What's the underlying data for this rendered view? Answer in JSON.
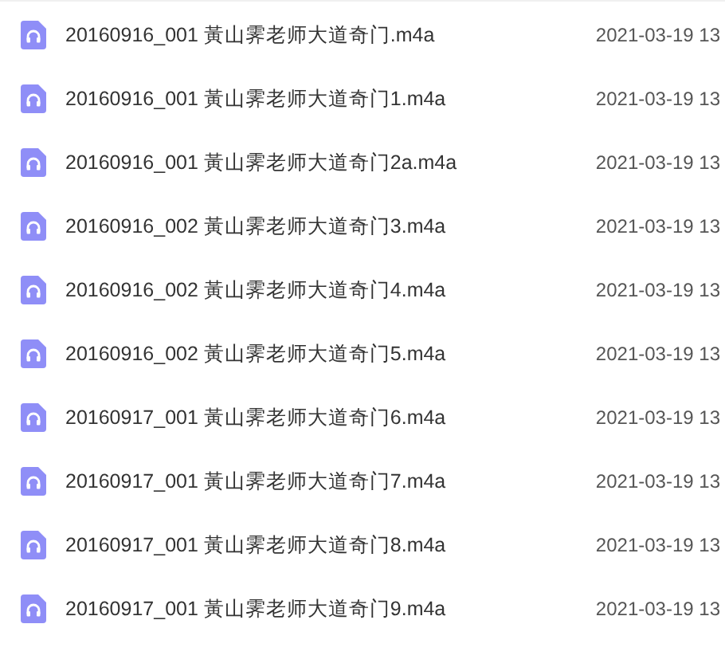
{
  "files": [
    {
      "name": "20160916_001 黃山霁老师大道奇门.m4a",
      "date": "2021-03-19 13"
    },
    {
      "name": "20160916_001 黃山霁老师大道奇门1.m4a",
      "date": "2021-03-19 13"
    },
    {
      "name": "20160916_001 黃山霁老师大道奇门2a.m4a",
      "date": "2021-03-19 13"
    },
    {
      "name": "20160916_002 黃山霁老师大道奇门3.m4a",
      "date": "2021-03-19 13"
    },
    {
      "name": "20160916_002 黃山霁老师大道奇门4.m4a",
      "date": "2021-03-19 13"
    },
    {
      "name": "20160916_002 黃山霁老师大道奇门5.m4a",
      "date": "2021-03-19 13"
    },
    {
      "name": "20160917_001 黃山霁老师大道奇门6.m4a",
      "date": "2021-03-19 13"
    },
    {
      "name": "20160917_001 黃山霁老师大道奇门7.m4a",
      "date": "2021-03-19 13"
    },
    {
      "name": "20160917_001 黃山霁老师大道奇门8.m4a",
      "date": "2021-03-19 13"
    },
    {
      "name": "20160917_001 黃山霁老师大道奇门9.m4a",
      "date": "2021-03-19 13"
    }
  ]
}
